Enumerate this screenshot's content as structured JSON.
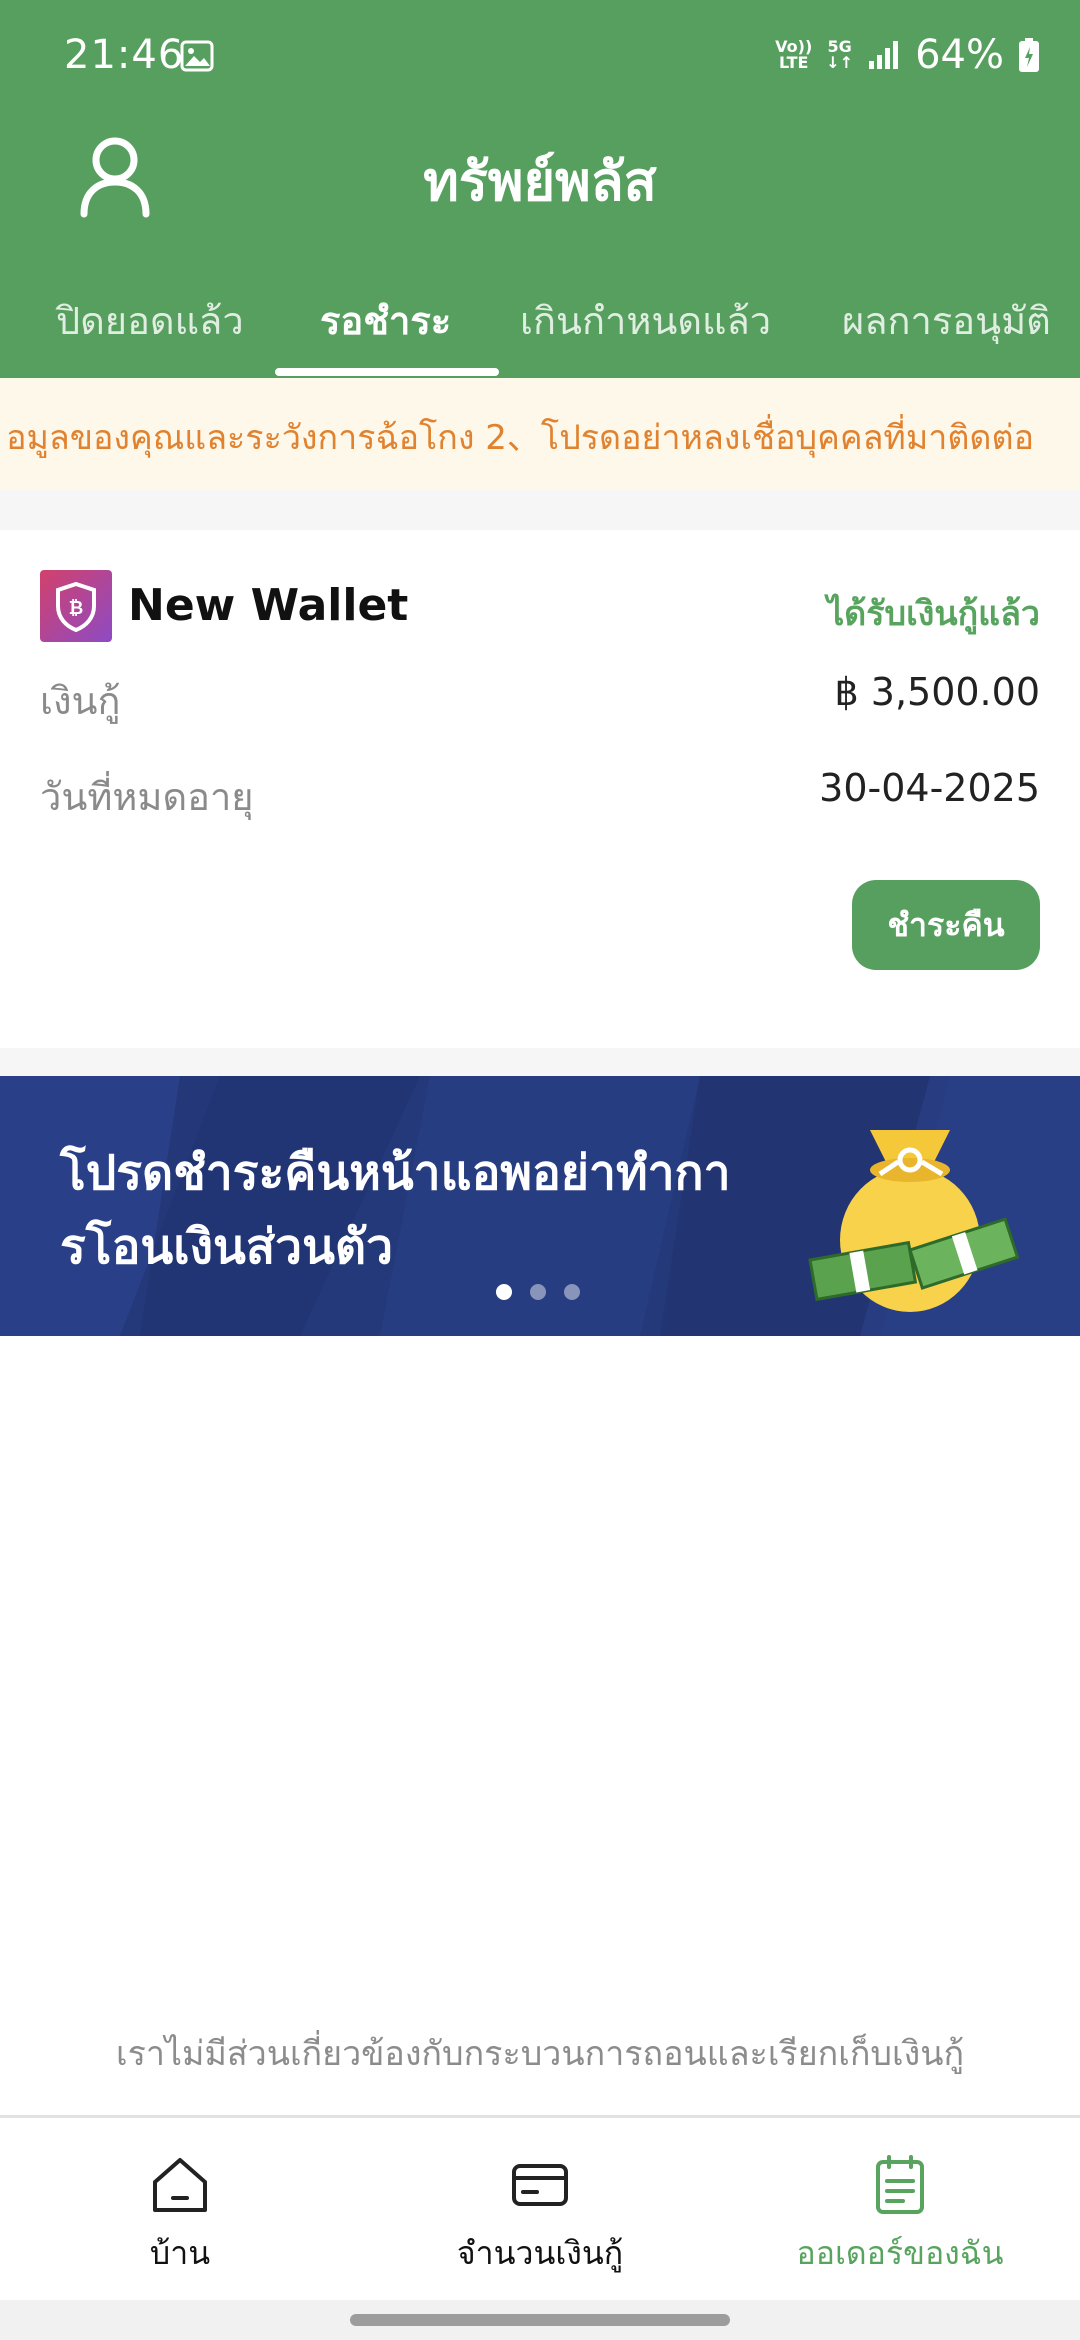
{
  "status_bar": {
    "time": "21:46",
    "network_top": "Vo))",
    "network_bottom": "LTE",
    "fiveg": "5G",
    "battery": "64%"
  },
  "header": {
    "title": "ทรัพย์พลัส"
  },
  "tabs": [
    {
      "label": "ปิดยอดแล้ว"
    },
    {
      "label": "รอชำระ"
    },
    {
      "label": "เกินกำหนดแล้ว"
    },
    {
      "label": "ผลการอนุมัติ"
    }
  ],
  "active_tab": "รอชำระ",
  "notice": {
    "text": "อมูลของคุณและระวังการฉ้อโกง 2、โปรดอย่าหลงเชื่อบุคคลที่มาติดต่อ"
  },
  "loan": {
    "wallet_name": "New Wallet",
    "status": "ได้รับเงินกู้แล้ว",
    "amount_label": "เงินกู้",
    "amount_value": "฿ 3,500.00",
    "expiry_label": "วันที่หมดอายุ",
    "expiry_value": "30-04-2025",
    "repay_button": "ชำระคืน"
  },
  "banner": {
    "line1": "โปรดชำระคืนหน้าแอพอย่าทำกา",
    "line2": "รโอนเงินส่วนตัว",
    "active_slide": 1,
    "slide_count": 3
  },
  "disclaimer": "เราไม่มีส่วนเกี่ยวข้องกับกระบวนการถอนและเรียกเก็บเงินกู้",
  "bottom_nav": {
    "items": [
      {
        "label": "บ้าน",
        "icon": "home-icon"
      },
      {
        "label": "จำนวนเงินกู้",
        "icon": "card-icon"
      },
      {
        "label": "ออเดอร์ของฉัน",
        "icon": "orders-icon"
      }
    ],
    "active": "ออเดอร์ของฉัน"
  },
  "colors": {
    "header_green": "#579f5f",
    "accent_green": "#58a45f",
    "notice_text": "#e0822f",
    "notice_bg": "#fdf8e9",
    "banner_blue": "#24397a"
  }
}
